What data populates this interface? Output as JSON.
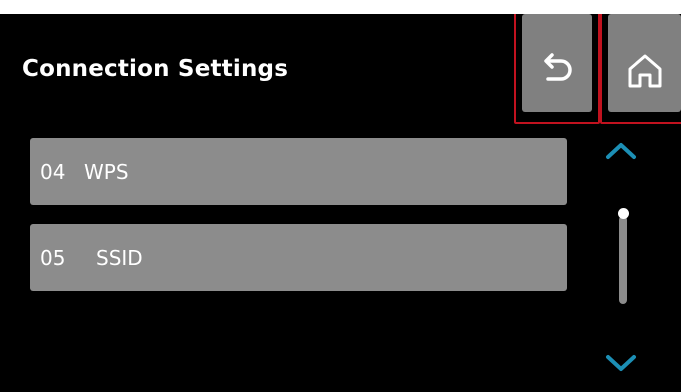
{
  "header": {
    "title": "Connection Settings"
  },
  "toolbar": {
    "back_icon": "back-arrow-icon",
    "home_icon": "home-icon",
    "highlight_color": "#c1121f",
    "button_color": "#808080"
  },
  "list": {
    "items": [
      {
        "number": "04",
        "label": "WPS"
      },
      {
        "number": "05",
        "label": "SSID"
      }
    ],
    "item_color": "#8c8c8c"
  },
  "scroll": {
    "up_icon": "chevron-up-icon",
    "down_icon": "chevron-down-icon",
    "accent_color": "#1c8fb5",
    "position": 0
  }
}
